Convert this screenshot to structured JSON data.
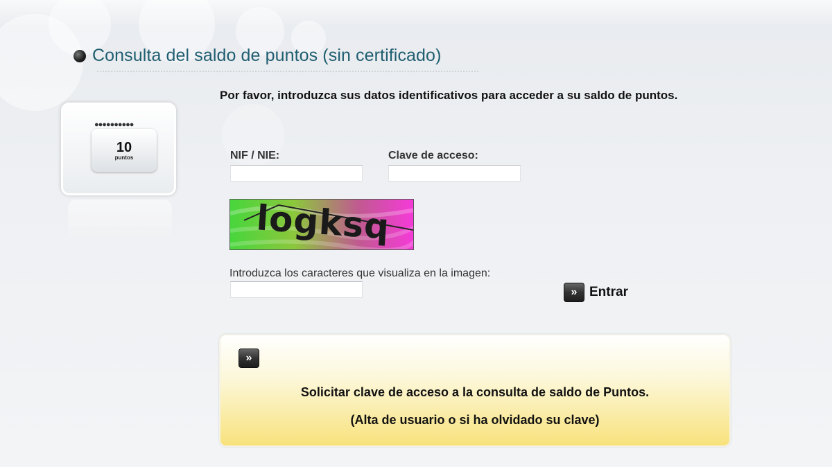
{
  "page_title": "Consulta del saldo de puntos (sin certificado)",
  "intro_text": "Por favor, introduzca sus datos identificativos para acceder a su saldo de puntos.",
  "points_card": {
    "value": "10",
    "unit": "puntos"
  },
  "form": {
    "nif_label": "NIF / NIE:",
    "nif_value": "",
    "password_label": "Clave de acceso:",
    "password_value": "",
    "captcha_text": "logksq",
    "captcha_label": "Introduzca los caracteres que visualiza en la imagen:",
    "captcha_value": ""
  },
  "enter_button": {
    "icon": "double-chevron-right-icon",
    "label": "Entrar"
  },
  "request_box": {
    "icon": "double-chevron-right-icon",
    "title": "Solicitar clave de acceso a la consulta de saldo de Puntos.",
    "subtitle": "(Alta de usuario o si ha olvidado su clave)"
  },
  "colors": {
    "title": "#1f5e70",
    "request_box": "#f8e27c",
    "captcha_left": "#47d63c",
    "captcha_right": "#f53ad8"
  }
}
